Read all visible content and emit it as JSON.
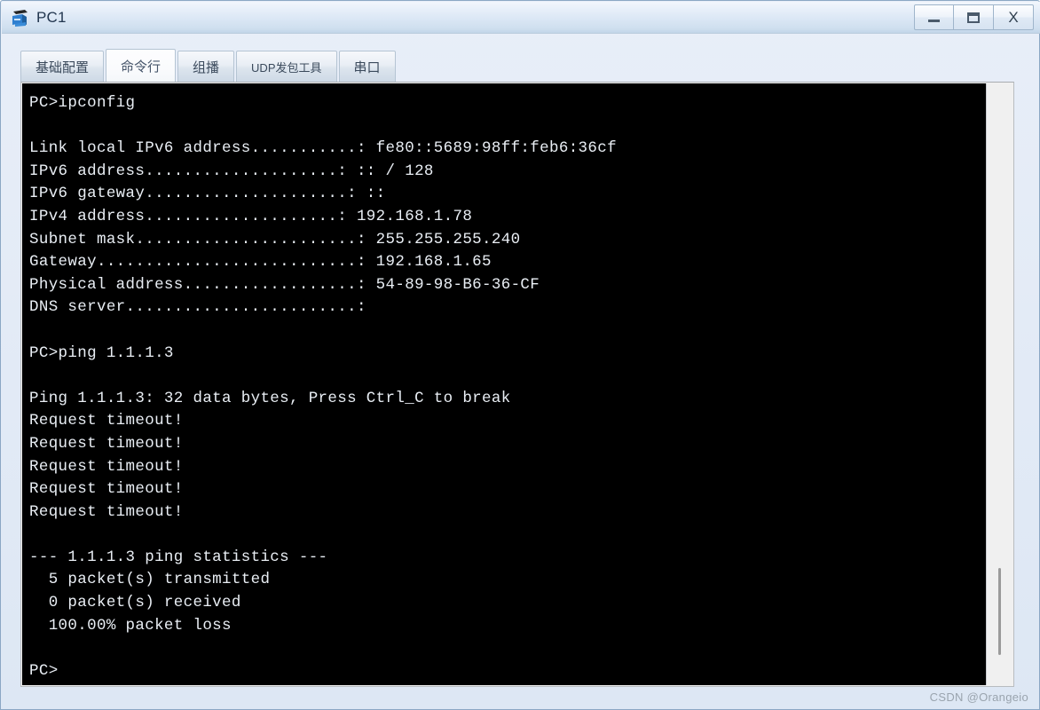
{
  "window": {
    "title": "PC1",
    "icon": "pc-computer-icon",
    "controls": {
      "minimize_label": "–",
      "maximize_label": "❐",
      "close_label": "X"
    },
    "frame_color": "#8ba7c4",
    "titlebar_color": "#dbe7f5"
  },
  "tabs": [
    {
      "label": "基础配置",
      "active": false,
      "small": false
    },
    {
      "label": "命令行",
      "active": true,
      "small": false
    },
    {
      "label": "组播",
      "active": false,
      "small": false
    },
    {
      "label": "UDP发包工具",
      "active": false,
      "small": true
    },
    {
      "label": "串口",
      "active": false,
      "small": false
    }
  ],
  "console": {
    "background_color": "#000000",
    "text_color": "#e9eef4",
    "lines": [
      "PC>ipconfig",
      "",
      "Link local IPv6 address...........: fe80::5689:98ff:feb6:36cf",
      "IPv6 address....................: :: / 128",
      "IPv6 gateway.....................: ::",
      "IPv4 address....................: 192.168.1.78",
      "Subnet mask.......................: 255.255.255.240",
      "Gateway...........................: 192.168.1.65",
      "Physical address..................: 54-89-98-B6-36-CF",
      "DNS server........................:",
      "",
      "PC>ping 1.1.1.3",
      "",
      "Ping 1.1.1.3: 32 data bytes, Press Ctrl_C to break",
      "Request timeout!",
      "Request timeout!",
      "Request timeout!",
      "Request timeout!",
      "Request timeout!",
      "",
      "--- 1.1.1.3 ping statistics ---",
      "  5 packet(s) transmitted",
      "  0 packet(s) received",
      "  100.00% packet loss",
      "",
      "PC>"
    ]
  },
  "watermark": {
    "text": "CSDN @Orangeio"
  }
}
